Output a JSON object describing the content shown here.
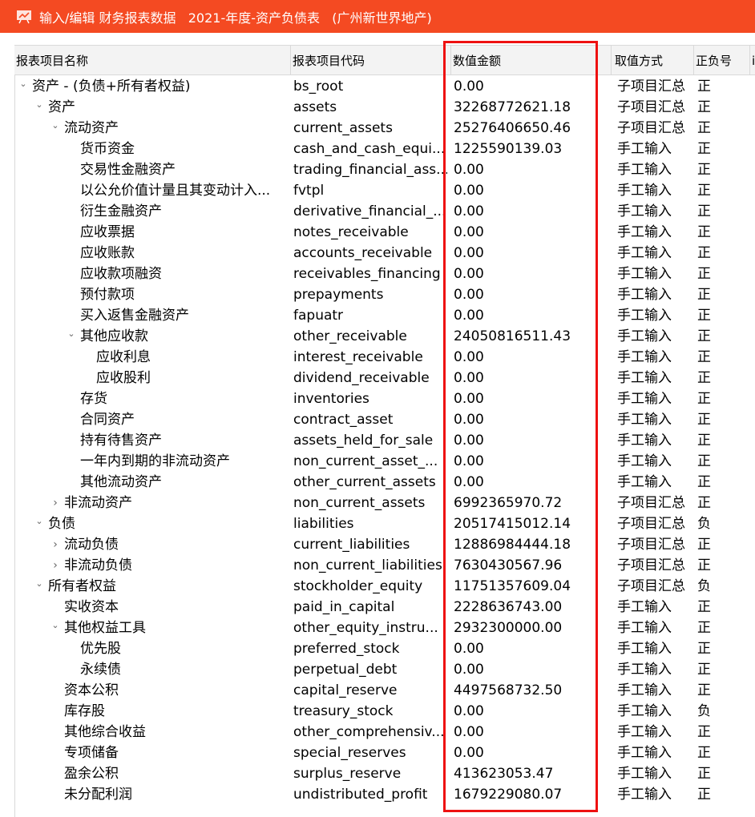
{
  "window": {
    "title": "输入/编辑 财务报表数据   2021-年度-资产负债表   (广州新世界地产)",
    "accent_color": "#f44a22",
    "icon": "presentation-chart-icon"
  },
  "grid": {
    "columns": [
      {
        "key": "name",
        "label": "报表项目名称"
      },
      {
        "key": "code",
        "label": "报表项目代码"
      },
      {
        "key": "value",
        "label": "数值金额"
      },
      {
        "key": "method",
        "label": "取值方式"
      },
      {
        "key": "sign",
        "label": "正负号"
      },
      {
        "key": "extra",
        "label": "i"
      }
    ],
    "highlight_column": "value",
    "highlight_color": "#ee1111",
    "rows": [
      {
        "level": 0,
        "toggle": "expanded",
        "name": "资产 - (负债+所有者权益)",
        "code": "bs_root",
        "value": "0.00",
        "method": "子项目汇总",
        "sign": "正"
      },
      {
        "level": 1,
        "toggle": "expanded",
        "name": "资产",
        "code": "assets",
        "value": "32268772621.18",
        "method": "子项目汇总",
        "sign": "正"
      },
      {
        "level": 2,
        "toggle": "expanded",
        "name": "流动资产",
        "code": "current_assets",
        "value": "25276406650.46",
        "method": "子项目汇总",
        "sign": "正"
      },
      {
        "level": 3,
        "toggle": "none",
        "name": "货币资金",
        "code": "cash_and_cash_equi...",
        "value": "1225590139.03",
        "method": "手工输入",
        "sign": "正"
      },
      {
        "level": 3,
        "toggle": "none",
        "name": "交易性金融资产",
        "code": "trading_financial_ass...",
        "value": "0.00",
        "method": "手工输入",
        "sign": "正"
      },
      {
        "level": 3,
        "toggle": "none",
        "name": "以公允价值计量且其变动计入...",
        "code": "fvtpl",
        "value": "0.00",
        "method": "手工输入",
        "sign": "正"
      },
      {
        "level": 3,
        "toggle": "none",
        "name": "衍生金融资产",
        "code": "derivative_financial_...",
        "value": "0.00",
        "method": "手工输入",
        "sign": "正"
      },
      {
        "level": 3,
        "toggle": "none",
        "name": "应收票据",
        "code": "notes_receivable",
        "value": "0.00",
        "method": "手工输入",
        "sign": "正"
      },
      {
        "level": 3,
        "toggle": "none",
        "name": "应收账款",
        "code": "accounts_receivable",
        "value": "0.00",
        "method": "手工输入",
        "sign": "正"
      },
      {
        "level": 3,
        "toggle": "none",
        "name": "应收款项融资",
        "code": "receivables_financing",
        "value": "0.00",
        "method": "手工输入",
        "sign": "正"
      },
      {
        "level": 3,
        "toggle": "none",
        "name": "预付款项",
        "code": "prepayments",
        "value": "0.00",
        "method": "手工输入",
        "sign": "正"
      },
      {
        "level": 3,
        "toggle": "none",
        "name": "买入返售金融资产",
        "code": "fapuatr",
        "value": "0.00",
        "method": "手工输入",
        "sign": "正"
      },
      {
        "level": 3,
        "toggle": "expanded",
        "name": "其他应收款",
        "code": "other_receivable",
        "value": "24050816511.43",
        "method": "手工输入",
        "sign": "正"
      },
      {
        "level": 4,
        "toggle": "none",
        "name": "应收利息",
        "code": "interest_receivable",
        "value": "0.00",
        "method": "手工输入",
        "sign": "正"
      },
      {
        "level": 4,
        "toggle": "none",
        "name": "应收股利",
        "code": "dividend_receivable",
        "value": "0.00",
        "method": "手工输入",
        "sign": "正"
      },
      {
        "level": 3,
        "toggle": "none",
        "name": "存货",
        "code": "inventories",
        "value": "0.00",
        "method": "手工输入",
        "sign": "正"
      },
      {
        "level": 3,
        "toggle": "none",
        "name": "合同资产",
        "code": "contract_asset",
        "value": "0.00",
        "method": "手工输入",
        "sign": "正"
      },
      {
        "level": 3,
        "toggle": "none",
        "name": "持有待售资产",
        "code": "assets_held_for_sale",
        "value": "0.00",
        "method": "手工输入",
        "sign": "正"
      },
      {
        "level": 3,
        "toggle": "none",
        "name": "一年内到期的非流动资产",
        "code": "non_current_asset_...",
        "value": "0.00",
        "method": "手工输入",
        "sign": "正"
      },
      {
        "level": 3,
        "toggle": "none",
        "name": "其他流动资产",
        "code": "other_current_assets",
        "value": "0.00",
        "method": "手工输入",
        "sign": "正"
      },
      {
        "level": 2,
        "toggle": "collapsed",
        "name": "非流动资产",
        "code": "non_current_assets",
        "value": "6992365970.72",
        "method": "子项目汇总",
        "sign": "正"
      },
      {
        "level": 1,
        "toggle": "expanded",
        "name": "负债",
        "code": "liabilities",
        "value": "20517415012.14",
        "method": "子项目汇总",
        "sign": "负"
      },
      {
        "level": 2,
        "toggle": "collapsed",
        "name": "流动负债",
        "code": "current_liabilities",
        "value": "12886984444.18",
        "method": "子项目汇总",
        "sign": "正"
      },
      {
        "level": 2,
        "toggle": "collapsed",
        "name": "非流动负债",
        "code": "non_current_liabilities",
        "value": "7630430567.96",
        "method": "子项目汇总",
        "sign": "正"
      },
      {
        "level": 1,
        "toggle": "expanded",
        "name": "所有者权益",
        "code": "stockholder_equity",
        "value": "11751357609.04",
        "method": "子项目汇总",
        "sign": "负"
      },
      {
        "level": 2,
        "toggle": "none",
        "name": "实收资本",
        "code": "paid_in_capital",
        "value": "2228636743.00",
        "method": "手工输入",
        "sign": "正"
      },
      {
        "level": 2,
        "toggle": "expanded",
        "name": "其他权益工具",
        "code": "other_equity_instru...",
        "value": "2932300000.00",
        "method": "手工输入",
        "sign": "正"
      },
      {
        "level": 3,
        "toggle": "none",
        "name": "优先股",
        "code": "preferred_stock",
        "value": "0.00",
        "method": "手工输入",
        "sign": "正"
      },
      {
        "level": 3,
        "toggle": "none",
        "name": "永续债",
        "code": "perpetual_debt",
        "value": "0.00",
        "method": "手工输入",
        "sign": "正"
      },
      {
        "level": 2,
        "toggle": "none",
        "name": "资本公积",
        "code": "capital_reserve",
        "value": "4497568732.50",
        "method": "手工输入",
        "sign": "正"
      },
      {
        "level": 2,
        "toggle": "none",
        "name": "库存股",
        "code": "treasury_stock",
        "value": "0.00",
        "method": "手工输入",
        "sign": "负"
      },
      {
        "level": 2,
        "toggle": "none",
        "name": "其他综合收益",
        "code": "other_comprehensiv...",
        "value": "0.00",
        "method": "手工输入",
        "sign": "正"
      },
      {
        "level": 2,
        "toggle": "none",
        "name": "专项储备",
        "code": "special_reserves",
        "value": "0.00",
        "method": "手工输入",
        "sign": "正"
      },
      {
        "level": 2,
        "toggle": "none",
        "name": "盈余公积",
        "code": "surplus_reserve",
        "value": "413623053.47",
        "method": "手工输入",
        "sign": "正"
      },
      {
        "level": 2,
        "toggle": "none",
        "name": "未分配利润",
        "code": "undistributed_profit",
        "value": "1679229080.07",
        "method": "手工输入",
        "sign": "正"
      }
    ]
  }
}
